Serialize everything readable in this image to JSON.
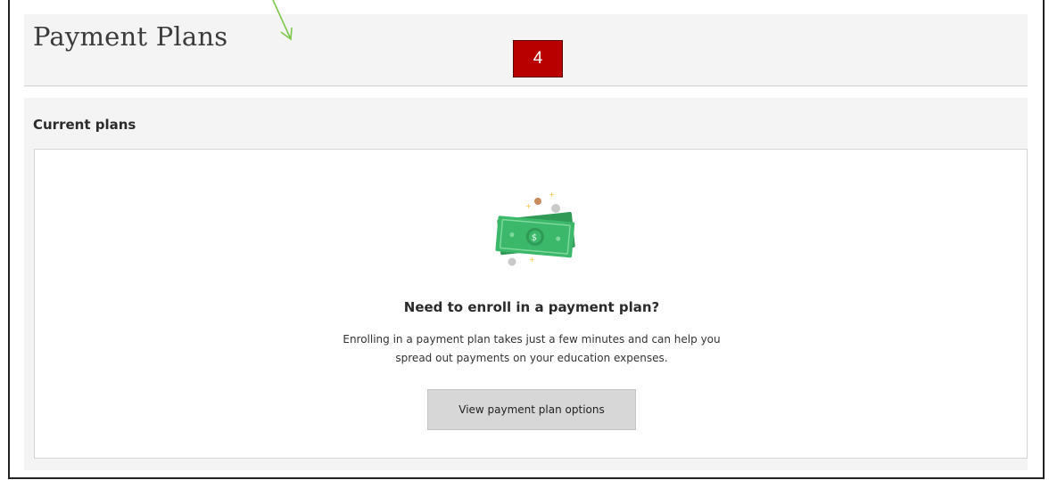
{
  "header": {
    "title": "Payment Plans",
    "step_badge": "4"
  },
  "current_plans": {
    "heading": "Current plans",
    "empty_state": {
      "illustration": "money-bills-icon",
      "title": "Need to enroll in a payment plan?",
      "description_line1": "Enrolling in a payment plan takes just a few minutes and can help you",
      "description_line2": "spread out payments on your education expenses.",
      "button_label": "View payment plan options"
    }
  },
  "colors": {
    "badge": "#b80000",
    "money_green": "#3cb86a",
    "arrow": "#7cc84a"
  }
}
